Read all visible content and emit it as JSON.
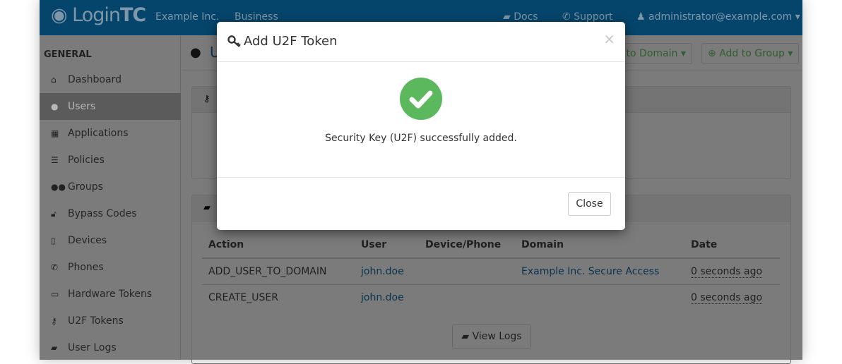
{
  "header": {
    "logo_text": "LoginTC",
    "org": "Example Inc.",
    "plan": "Business",
    "docs": "Docs",
    "support": "Support",
    "account": "administrator@example.com",
    "brand_color": "#0a8ad6"
  },
  "sidebar": {
    "heading": "GENERAL",
    "items": [
      {
        "label": "Dashboard",
        "icon": "home-icon"
      },
      {
        "label": "Users",
        "icon": "user-icon",
        "active": true
      },
      {
        "label": "Applications",
        "icon": "grid-icon"
      },
      {
        "label": "Policies",
        "icon": "list-icon"
      },
      {
        "label": "Groups",
        "icon": "users-icon"
      },
      {
        "label": "Bypass Codes",
        "icon": "unlock-icon"
      },
      {
        "label": "Devices",
        "icon": "mobile-icon"
      },
      {
        "label": "Phones",
        "icon": "phone-icon"
      },
      {
        "label": "Hardware Tokens",
        "icon": "hdd-icon"
      },
      {
        "label": "U2F Tokens",
        "icon": "key-icon"
      },
      {
        "label": "User Logs",
        "icon": "book-icon"
      }
    ]
  },
  "page": {
    "title": "U",
    "add_to_domain": "Add to Domain",
    "add_to_group": "Add to Group"
  },
  "logs": {
    "columns": [
      "Action",
      "User",
      "Device/Phone",
      "Domain",
      "Date"
    ],
    "rows": [
      {
        "action": "ADD_USER_TO_DOMAIN",
        "user": "john.doe",
        "device": "",
        "domain": "Example Inc. Secure Access",
        "date": "0 seconds ago"
      },
      {
        "action": "CREATE_USER",
        "user": "john.doe",
        "device": "",
        "domain": "",
        "date": "0 seconds ago"
      }
    ],
    "view_logs": "View Logs"
  },
  "modal": {
    "title": "Add U2F Token",
    "message": "Security Key (U2F) successfully added.",
    "close": "Close",
    "close_x": "×",
    "success_color": "#5cb85c"
  }
}
